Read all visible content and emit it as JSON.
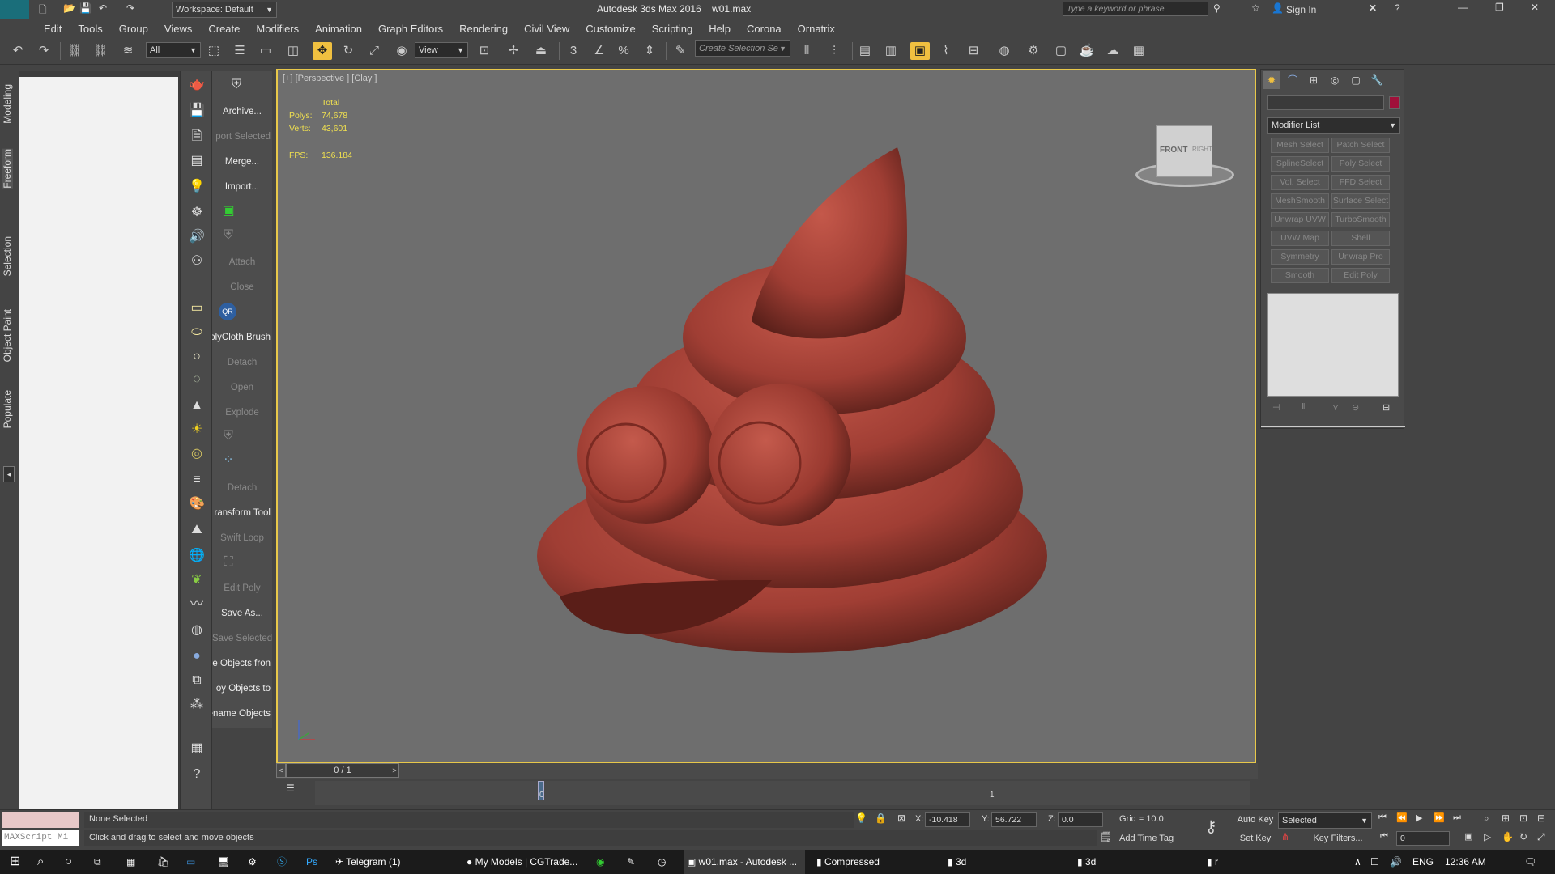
{
  "app": {
    "title": "Autodesk 3ds Max 2016",
    "file": "w01.max",
    "logo": "MAX",
    "workspace": "Workspace: Default",
    "search_placeholder": "Type a keyword or phrase",
    "sign_in": "Sign In"
  },
  "menu": [
    "Edit",
    "Tools",
    "Group",
    "Views",
    "Create",
    "Modifiers",
    "Animation",
    "Graph Editors",
    "Rendering",
    "Civil View",
    "Customize",
    "Scripting",
    "Help",
    "Corona",
    "Ornatrix"
  ],
  "toolbar": {
    "filter": "All",
    "ref_coord": "View",
    "selection_set": "Create Selection Se"
  },
  "left_tabs": [
    "Modeling",
    "Freeform",
    "Selection",
    "Object Paint",
    "Populate"
  ],
  "commands": [
    {
      "label": "Archive...",
      "dim": false
    },
    {
      "label": "port Selected",
      "dim": true
    },
    {
      "label": "Merge...",
      "dim": false
    },
    {
      "label": "Import...",
      "dim": false
    },
    {
      "label": "Attach",
      "dim": true
    },
    {
      "label": "Close",
      "dim": true
    },
    {
      "label": "olyCloth Brush",
      "dim": false
    },
    {
      "label": "Detach",
      "dim": true
    },
    {
      "label": "Open",
      "dim": true
    },
    {
      "label": "Explode",
      "dim": true
    },
    {
      "label": "Detach",
      "dim": true
    },
    {
      "label": "ransform Tool",
      "dim": false
    },
    {
      "label": "Swift Loop",
      "dim": true
    },
    {
      "label": "Edit Poly",
      "dim": true
    },
    {
      "label": "Save As...",
      "dim": false
    },
    {
      "label": "Save Selected",
      "dim": true
    },
    {
      "label": "e Objects fron",
      "dim": false
    },
    {
      "label": "oy Objects to",
      "dim": false
    },
    {
      "label": "ename Objects",
      "dim": false
    }
  ],
  "viewport": {
    "label": "[+] [Perspective ] [Clay ]",
    "stats": {
      "total": "Total",
      "polys_label": "Polys:",
      "polys": "74,678",
      "verts_label": "Verts:",
      "verts": "43,601",
      "fps_label": "FPS:",
      "fps": "136.184"
    },
    "viewcube_front": "FRONT",
    "viewcube_right": "RIGHT"
  },
  "modify_panel": {
    "modifier_list": "Modifier List",
    "buttons": [
      "Mesh Select",
      "Patch Select",
      "SplineSelect",
      "Poly Select",
      "Vol. Select",
      "FFD Select",
      "MeshSmooth",
      "Surface Select",
      "Unwrap UVW",
      "TurboSmooth",
      "UVW Map",
      "Shell",
      "Symmetry",
      "Unwrap Pro",
      "Smooth",
      "Edit Poly"
    ],
    "color": "#a0103a"
  },
  "timeline": {
    "frame": "0 / 1",
    "tick_0": "0",
    "tick_1": "1"
  },
  "status": {
    "maxscript": "MAXScript Mi",
    "selected": "None Selected",
    "prompt": "Click and drag to select and move objects",
    "x_label": "X:",
    "x": "-10.418",
    "y_label": "Y:",
    "y": "56.722",
    "z_label": "Z:",
    "z": "0.0",
    "grid": "Grid = 10.0",
    "add_time_tag": "Add Time Tag",
    "auto_key": "Auto Key",
    "set_key": "Set Key",
    "key_mode": "Selected",
    "key_filters": "Key Filters...",
    "frame_field": "0"
  },
  "taskbar": {
    "items": [
      "Telegram (1)",
      "My Models | CGTrade...",
      "w01.max - Autodesk ...",
      "Compressed",
      "3d",
      "3d",
      "r"
    ],
    "lang": "ENG",
    "time": "12:36 AM"
  }
}
